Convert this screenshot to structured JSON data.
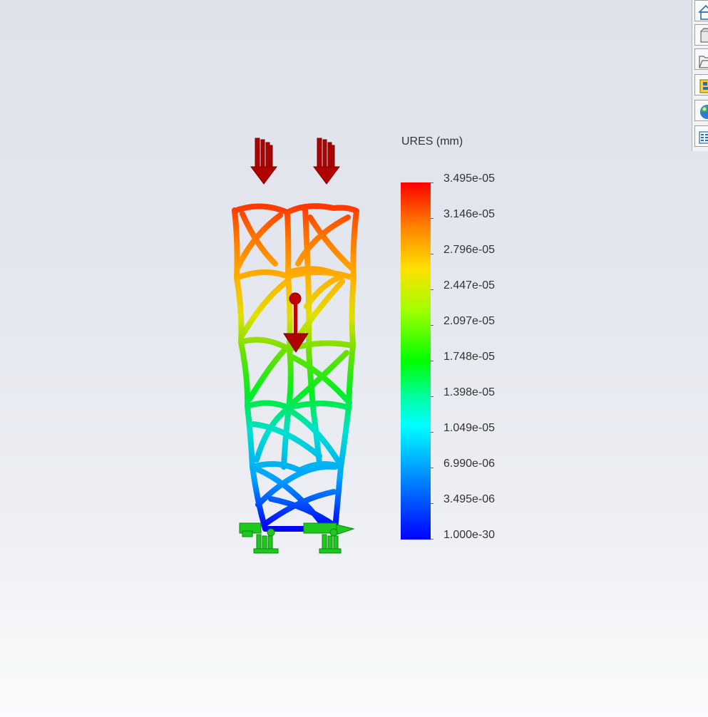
{
  "legend": {
    "title": "URES (mm)",
    "labels": [
      "3.495e-05",
      "3.146e-05",
      "2.796e-05",
      "2.447e-05",
      "2.097e-05",
      "1.748e-05",
      "1.398e-05",
      "1.049e-05",
      "6.990e-06",
      "3.495e-06",
      "1.000e-30"
    ],
    "max_color": "#ff0000",
    "min_color": "#0000ff"
  },
  "colors": {
    "load_arrow": "#b00000",
    "fixture": "#1ec81e",
    "background_top": "#dfe2ea",
    "background_bottom": "#fbfbfc"
  },
  "taskpane": {
    "items": [
      {
        "icon": "home-icon"
      },
      {
        "icon": "3d-parts-icon"
      },
      {
        "icon": "folder-icon"
      },
      {
        "icon": "view-palette-icon"
      },
      {
        "icon": "appearances-icon"
      },
      {
        "icon": "custom-properties-icon"
      }
    ]
  }
}
